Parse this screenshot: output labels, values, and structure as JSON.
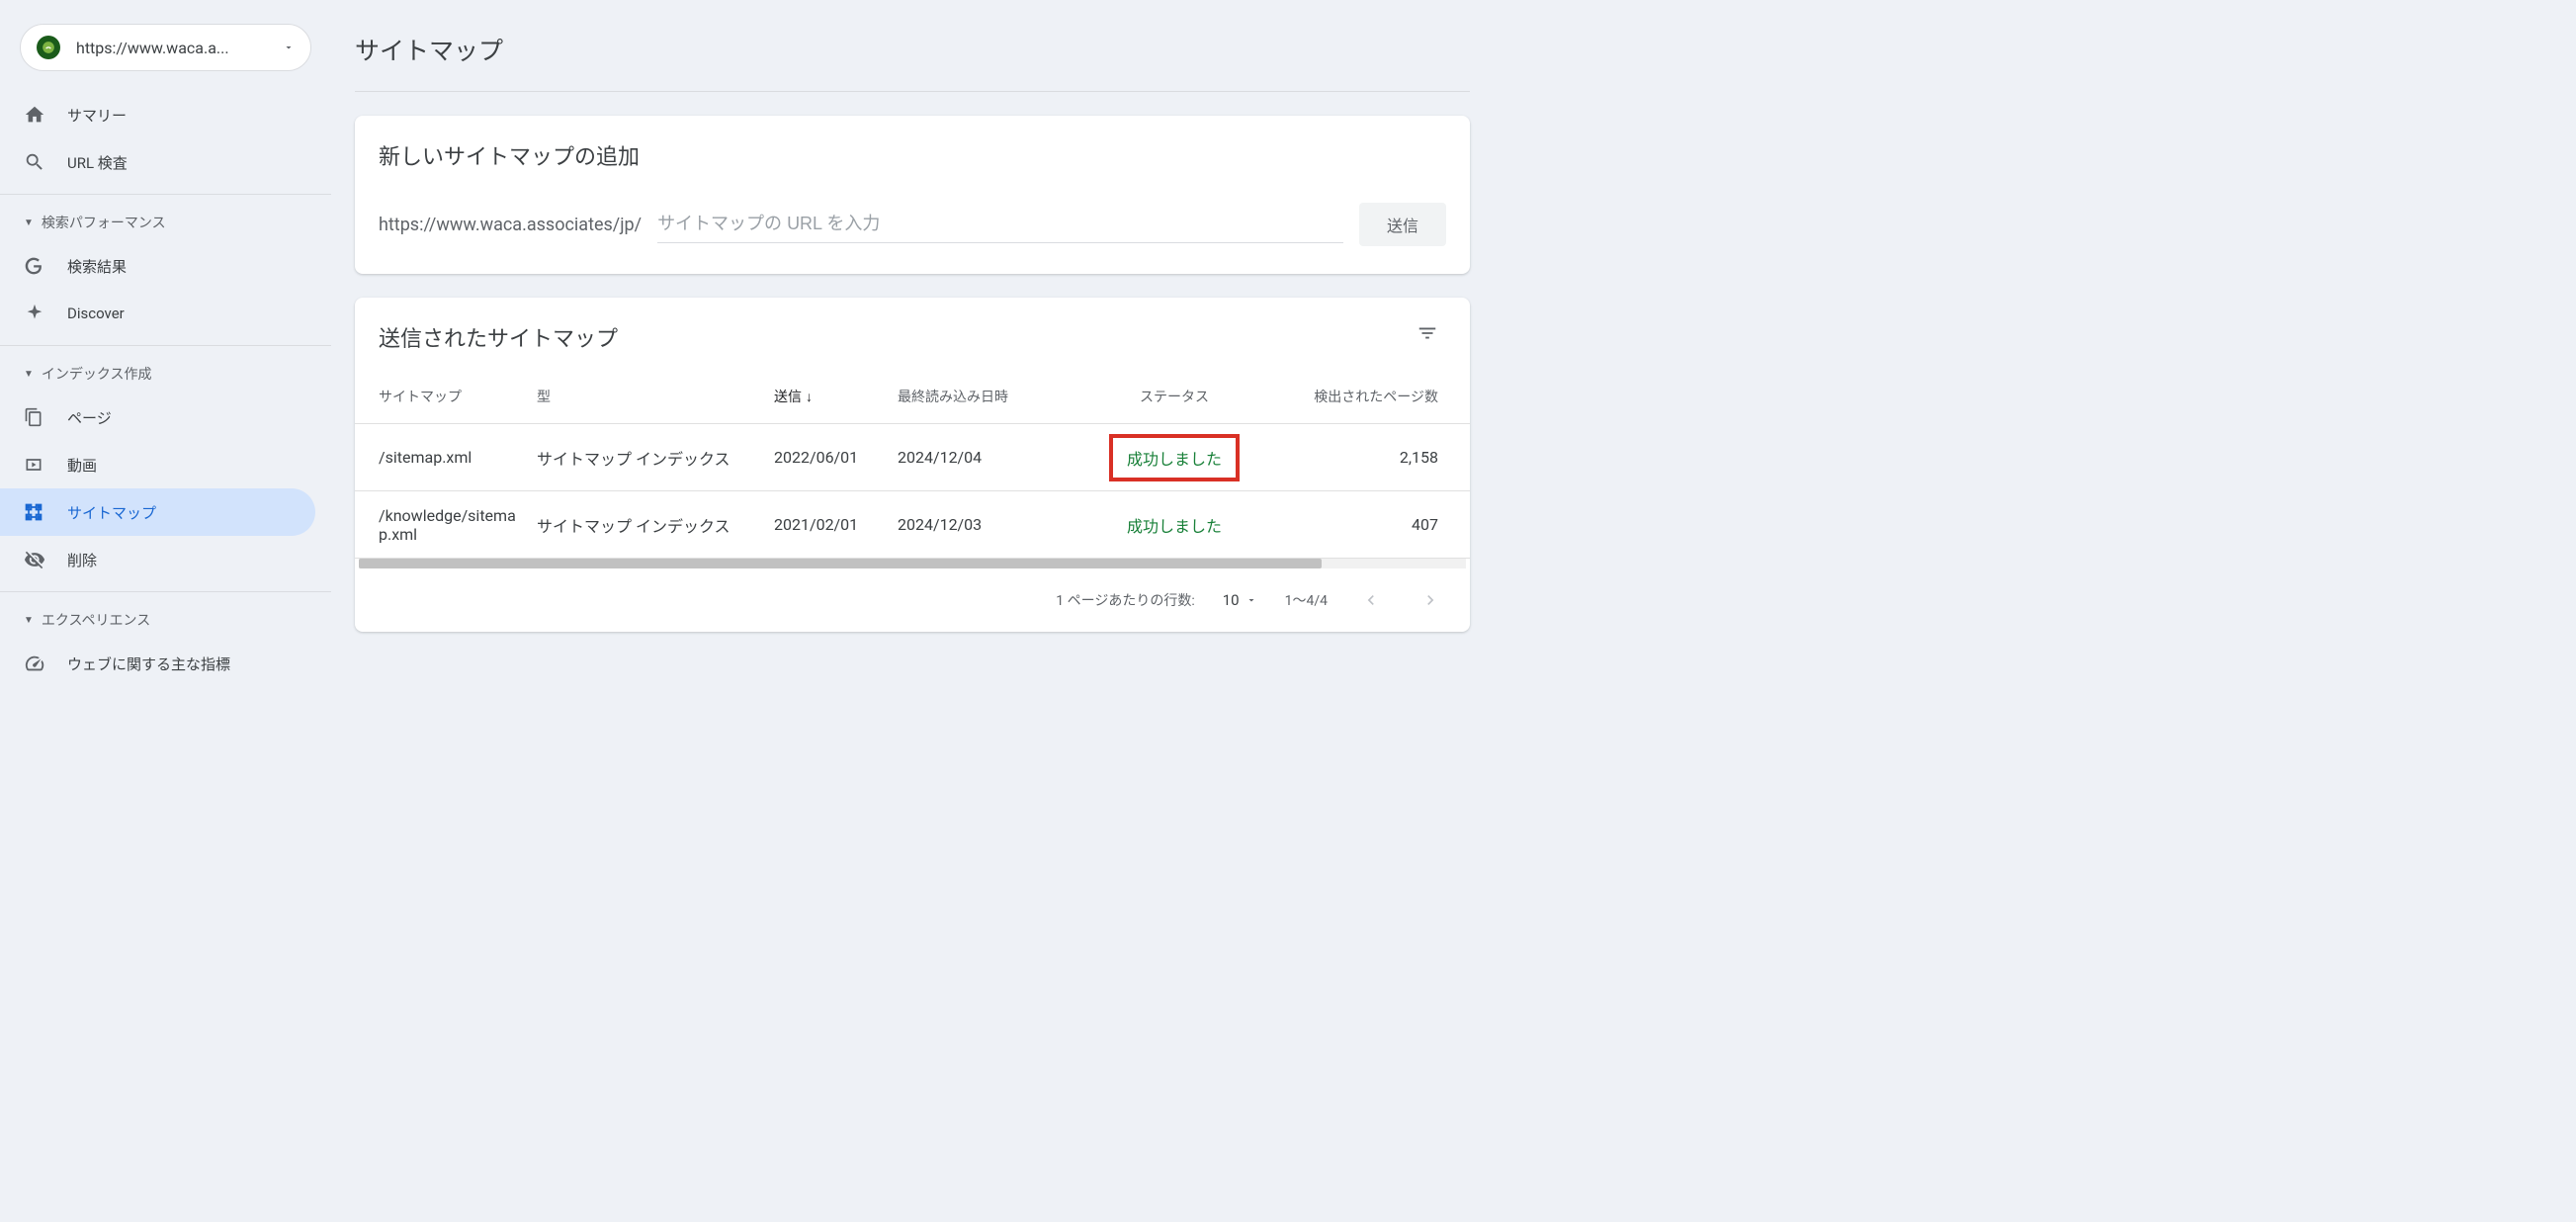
{
  "property": {
    "url": "https://www.waca.a..."
  },
  "sidebar": {
    "summary": "サマリー",
    "url_inspect": "URL 検査",
    "section_performance": "検索パフォーマンス",
    "search_results": "検索結果",
    "discover": "Discover",
    "section_indexing": "インデックス作成",
    "pages": "ページ",
    "videos": "動画",
    "sitemaps": "サイトマップ",
    "removals": "削除",
    "section_experience": "エクスペリエンス",
    "core_web_vitals": "ウェブに関する主な指標"
  },
  "page": {
    "title": "サイトマップ"
  },
  "add_card": {
    "title": "新しいサイトマップの追加",
    "url_prefix": "https://www.waca.associates/jp/",
    "placeholder": "サイトマップの URL を入力",
    "submit": "送信"
  },
  "list_card": {
    "title": "送信されたサイトマップ",
    "columns": {
      "sitemap": "サイトマップ",
      "type": "型",
      "submitted": "送信",
      "last_read": "最終読み込み日時",
      "status": "ステータス",
      "pages": "検出されたページ数"
    },
    "rows": [
      {
        "sitemap": "/sitemap.xml",
        "type": "サイトマップ インデックス",
        "submitted": "2022/06/01",
        "last_read": "2024/12/04",
        "status": "成功しました",
        "pages": "2,158",
        "highlight": true
      },
      {
        "sitemap": "/knowledge/sitemap.xml",
        "type": "サイトマップ インデックス",
        "submitted": "2021/02/01",
        "last_read": "2024/12/03",
        "status": "成功しました",
        "pages": "407",
        "highlight": false
      }
    ],
    "pagination": {
      "rows_label": "1 ページあたりの行数:",
      "rows_value": "10",
      "range": "1～4/4"
    }
  }
}
